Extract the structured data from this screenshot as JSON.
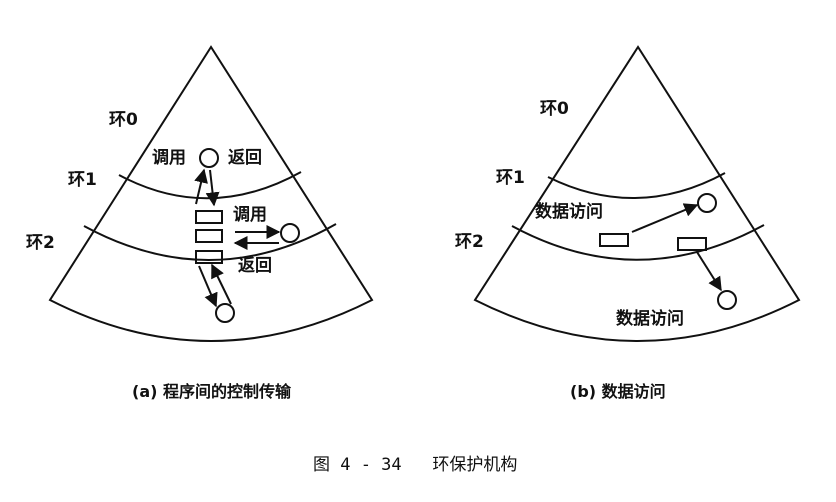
{
  "figure_caption": "图 4 - 34   环保护机构",
  "left_diagram": {
    "caption": "(a) 程序间的控制传输",
    "ring_labels": [
      "环0",
      "环1",
      "环2"
    ],
    "call_label_top": "调用",
    "return_label_top": "返回",
    "call_label_mid": "调用",
    "return_label_mid": "返回"
  },
  "right_diagram": {
    "caption": "(b) 数据访问",
    "ring_labels": [
      "环0",
      "环1",
      "环2"
    ],
    "data_access_label_ring1": "数据访问",
    "data_access_label_ring2": "数据访问"
  }
}
